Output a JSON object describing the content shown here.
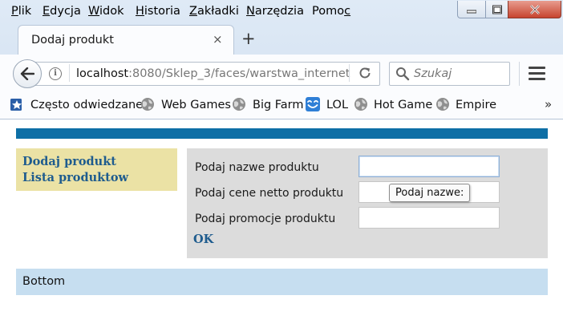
{
  "menubar": {
    "items": [
      {
        "pre": "",
        "u": "P",
        "post": "lik"
      },
      {
        "pre": "",
        "u": "E",
        "post": "dycja"
      },
      {
        "pre": "",
        "u": "W",
        "post": "idok"
      },
      {
        "pre": "",
        "u": "H",
        "post": "istoria"
      },
      {
        "pre": "",
        "u": "Z",
        "post": "akładki"
      },
      {
        "pre": "",
        "u": "N",
        "post": "arzędzia"
      },
      {
        "pre": "Pomo",
        "u": "c",
        "post": ""
      }
    ]
  },
  "tab": {
    "title": "Dodaj produkt",
    "close_glyph": "×"
  },
  "new_tab_glyph": "+",
  "url": {
    "host": "localhost",
    "rest": ":8080/Sklep_3/faces/warstwa_internet"
  },
  "search": {
    "placeholder": "Szukaj"
  },
  "bookmarks": [
    {
      "label": "Często odwiedzane",
      "icon": "bookmark-star-icon"
    },
    {
      "label": "Web Games",
      "icon": "globe-icon"
    },
    {
      "label": "Big Farm",
      "icon": "globe-icon"
    },
    {
      "label": "LOL",
      "icon": "smiley-icon"
    },
    {
      "label": "Hot Game",
      "icon": "globe-icon"
    },
    {
      "label": "Empire",
      "icon": "globe-icon"
    }
  ],
  "bookmarks_more": "»",
  "left_menu": {
    "add_product": "Dodaj produkt",
    "product_list": "Lista produktow"
  },
  "form": {
    "name_label": "Podaj nazwe produktu",
    "price_label": "Podaj cene netto produktu",
    "promo_label": "Podaj promocje produktu",
    "name_value": "",
    "price_value": "",
    "promo_value": "",
    "submit": "OK",
    "tooltip": "Podaj nazwe:"
  },
  "footer": {
    "text": "Bottom"
  },
  "colors": {
    "topbar": "#0e6fa6",
    "leftmenu": "#ebe2a5",
    "formpanel": "#dcdcdc",
    "footer": "#c6def0",
    "link": "#1f5c8e"
  }
}
